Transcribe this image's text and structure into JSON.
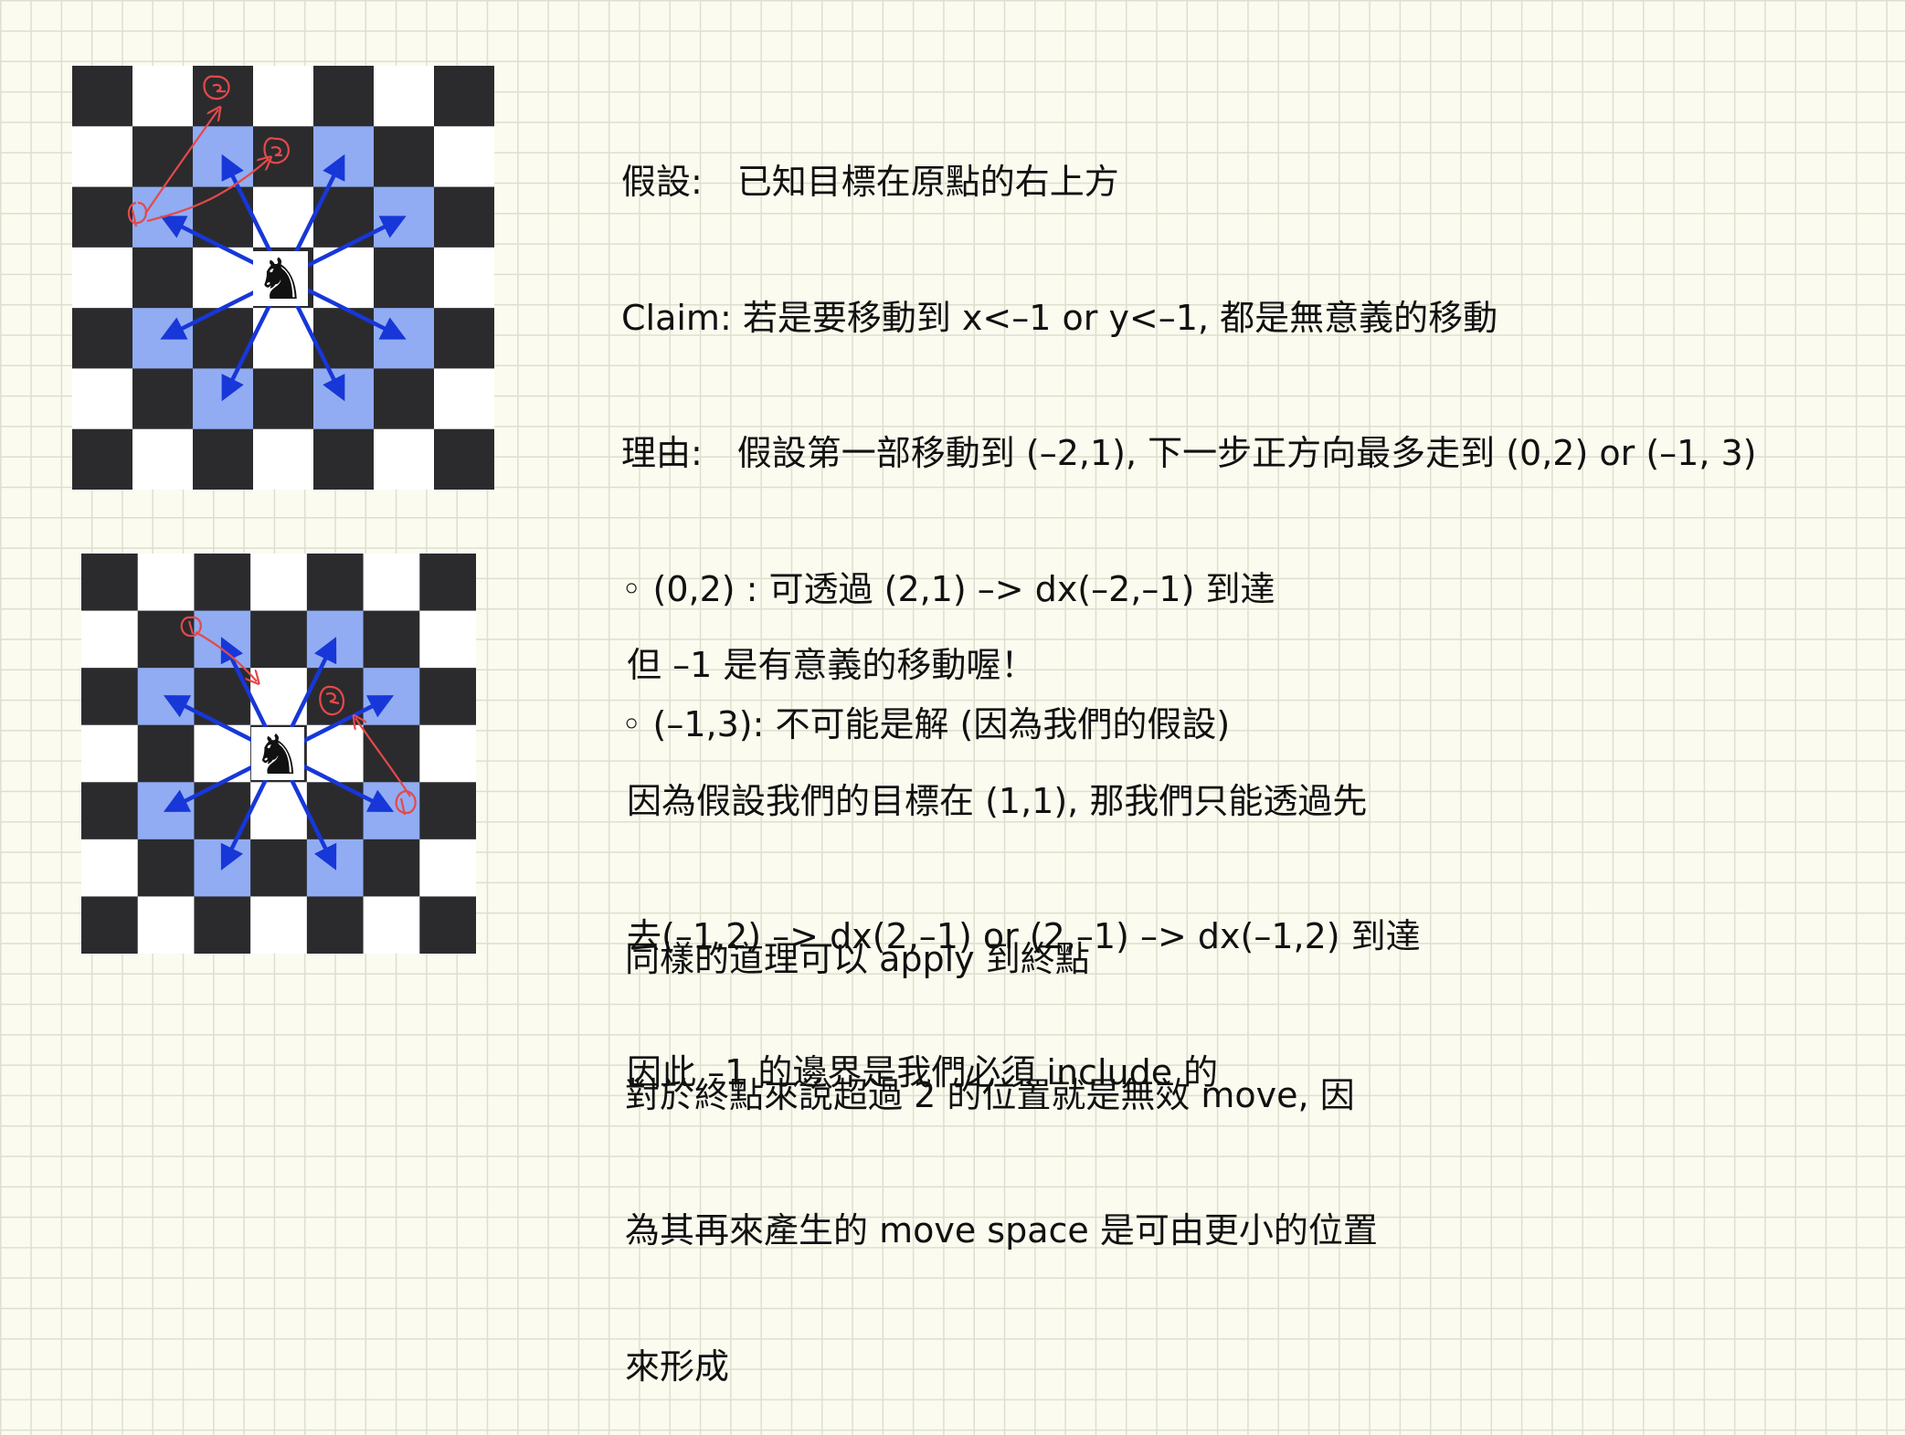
{
  "note1": {
    "lines": [
      "假設:　已知目標在原點的右上方",
      "Claim: 若是要移動到 x<–1 or y<–1, 都是無意義的移動",
      "理由:　假設第一部移動到 (–2,1), 下一步正方向最多走到 (0,2) or (–1, 3)",
      "◦ (0,2) : 可透過 (2,1) –> dx(–2,–1) 到達",
      "◦ (–1,3): 不可能是解 (因為我們的假設)"
    ]
  },
  "note2": {
    "lines": [
      "但 –1 是有意義的移動喔！",
      "因為假設我們的目標在 (1,1), 那我們只能透過先",
      "去(–1,2) –> dx(2,–1) or (2,–1) –> dx(–1,2) 到達",
      "因此 –1 的邊界是我們必須 include 的"
    ]
  },
  "note3": {
    "lines": [
      "同樣的道理可以 apply 到終點",
      "對於終點來說超過 2 的位置就是無效 move, 因",
      "為其再來產生的 move space 是可由更小的位置",
      "來形成"
    ]
  },
  "boards": {
    "square_dark": "#2b2b2e",
    "square_light": "#ffffff",
    "square_highlight": "#91acf2",
    "arrow_blue": "#1737d8",
    "ink_red": "#e4494a",
    "knight_piece": "♞"
  }
}
